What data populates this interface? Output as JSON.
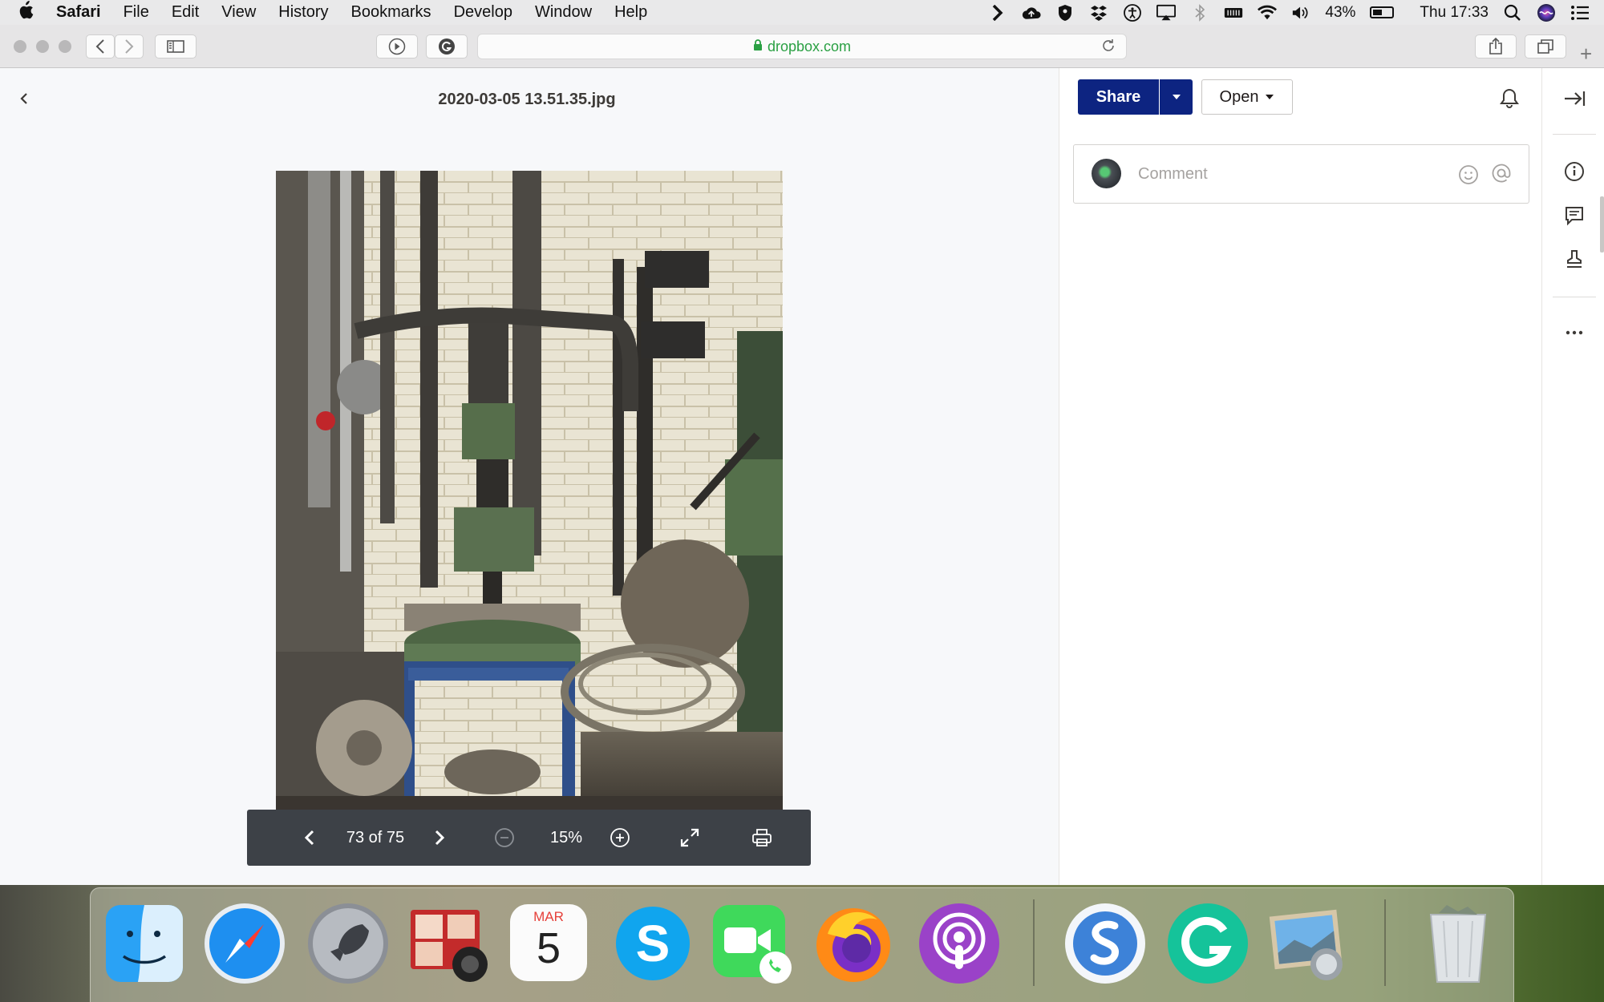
{
  "menubar": {
    "app_name": "Safari",
    "menus": [
      "File",
      "Edit",
      "View",
      "History",
      "Bookmarks",
      "Develop",
      "Window",
      "Help"
    ],
    "battery_percent": "43%",
    "clock": "Thu 17:33"
  },
  "browser": {
    "url": "dropbox.com"
  },
  "viewer": {
    "file_name": "2020-03-05 13.51.35.jpg",
    "page_indicator": "73 of 75",
    "zoom": "15%"
  },
  "sidebar": {
    "share_label": "Share",
    "open_label": "Open",
    "comment_placeholder": "Comment"
  },
  "dock": {
    "calendar_month": "MAR",
    "calendar_day": "5",
    "items": [
      "Finder",
      "Safari",
      "Launchpad",
      "Photo Booth",
      "Calendar",
      "Skype",
      "FaceTime",
      "Firefox",
      "Podcasts",
      "Simplenote",
      "Grammarly",
      "Preview",
      "Trash"
    ]
  },
  "colors": {
    "share_blue": "#0d2481",
    "url_green": "#2aa043",
    "controls_bg": "#3d4147"
  }
}
